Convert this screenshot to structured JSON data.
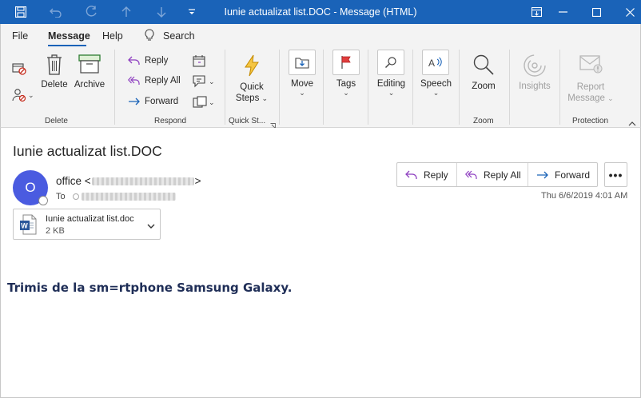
{
  "window": {
    "title": "Iunie actualizat list.DOC  -  Message (HTML)",
    "title_bar_color": "#1a63b8"
  },
  "menu": {
    "file": "File",
    "message": "Message",
    "help": "Help",
    "search": "Search"
  },
  "ribbon": {
    "delete_label": "Delete",
    "archive_label": "Archive",
    "group_delete": "Delete",
    "reply_label": "Reply",
    "reply_all_label": "Reply All",
    "forward_label": "Forward",
    "group_respond": "Respond",
    "quick_steps_line1": "Quick",
    "quick_steps_line2": "Steps",
    "group_quick_steps": "Quick St...",
    "move_label": "Move",
    "tags_label": "Tags",
    "editing_label": "Editing",
    "speech_label": "Speech",
    "zoom_label": "Zoom",
    "group_zoom": "Zoom",
    "insights_label": "Insights",
    "report_line1": "Report",
    "report_line2": "Message",
    "group_protection": "Protection"
  },
  "message": {
    "subject": "Iunie actualizat list.DOC",
    "avatar_initial": "O",
    "sender_name": "office <",
    "sender_close": ">",
    "to_label": "To",
    "timestamp": "Thu 6/6/2019 4:01 AM",
    "actions": {
      "reply": "Reply",
      "reply_all": "Reply All",
      "forward": "Forward"
    },
    "attachment": {
      "name": "Iunie actualizat list.doc",
      "size": "2 KB"
    },
    "body": "Trimis de la sm=rtphone Samsung Galaxy."
  }
}
